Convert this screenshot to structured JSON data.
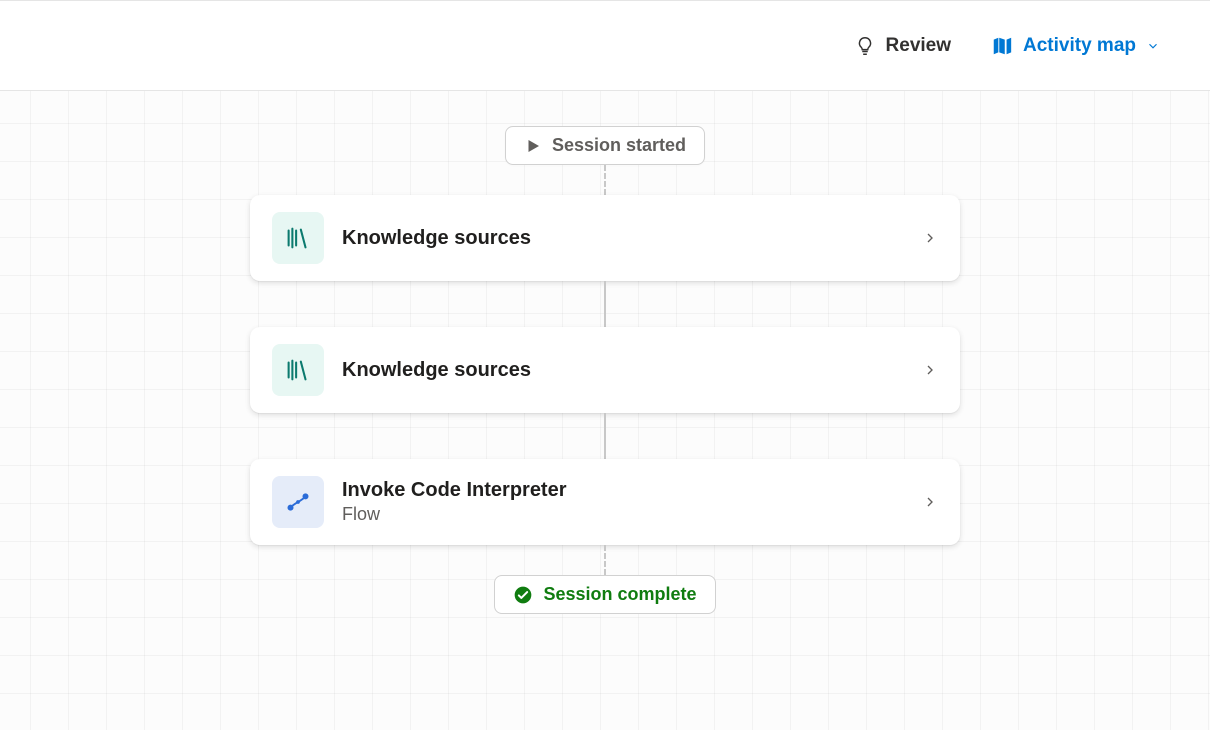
{
  "header": {
    "review_label": "Review",
    "activity_map_label": "Activity map"
  },
  "flow": {
    "start_label": "Session started",
    "end_label": "Session complete",
    "steps": [
      {
        "title": "Knowledge sources",
        "subtitle": null,
        "icon": "books",
        "icon_bg": "teal"
      },
      {
        "title": "Knowledge sources",
        "subtitle": null,
        "icon": "books",
        "icon_bg": "teal"
      },
      {
        "title": "Invoke Code Interpreter",
        "subtitle": "Flow",
        "icon": "flow",
        "icon_bg": "blue"
      }
    ]
  },
  "colors": {
    "accent": "#0078d4",
    "success": "#107c10",
    "text_primary": "#201f1e",
    "text_secondary": "#605e5c"
  }
}
